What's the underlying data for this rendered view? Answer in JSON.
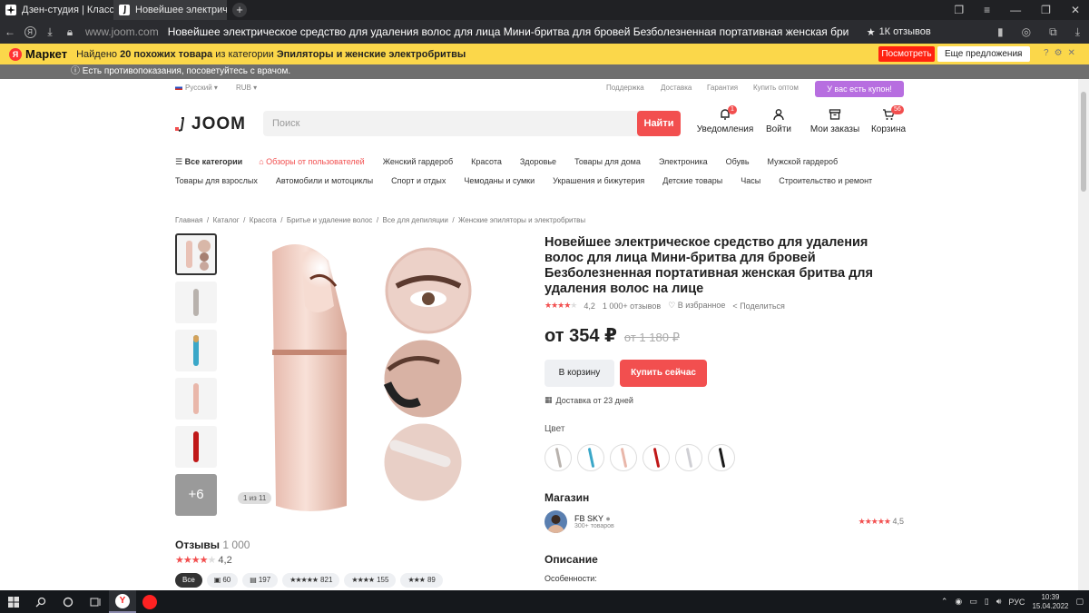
{
  "browser": {
    "tabs": [
      {
        "label": "Дзен-студия | Классный т"
      },
      {
        "label": "Новейшее электрическ"
      }
    ],
    "address_host": "www.joom.com",
    "page_title": "Новейшее электрическое средство для удаления волос для лица Мини-бритва для бровей Безболезненная портативная женская бритва для удаления волос не...",
    "reviews_pill": "1К отзывов"
  },
  "market_bar": {
    "brand": "Маркет",
    "text_pre": "Найдено ",
    "count": "20",
    "text_mid": " похожих товара",
    "text_post": " из категории ",
    "category": "Эпиляторы и женские электробритвы",
    "look_button": "Посмотреть",
    "more_offers": "Еще предложения"
  },
  "warning": "Есть противопоказания, посоветуйтесь с врачом.",
  "utility": {
    "language": "Русский",
    "currency": "RUB",
    "links": [
      "Поддержка",
      "Доставка",
      "Гарантия",
      "Купить оптом"
    ],
    "coupon": "У вас есть купон!"
  },
  "header": {
    "logo": "JOOM",
    "search_placeholder": "Поиск",
    "search_button": "Найти",
    "icons": [
      {
        "label": "Уведомления",
        "badge": "1"
      },
      {
        "label": "Войти",
        "badge": ""
      },
      {
        "label": "Мои заказы",
        "badge": ""
      },
      {
        "label": "Корзина",
        "badge": "56"
      }
    ]
  },
  "categories_row1": [
    "Все категории",
    "Обзоры от пользователей",
    "Женский гардероб",
    "Красота",
    "Здоровье",
    "Товары для дома",
    "Электроника",
    "Обувь",
    "Мужской гардероб"
  ],
  "categories_row2": [
    "Товары для взрослых",
    "Автомобили и мотоциклы",
    "Спорт и отдых",
    "Чемоданы и сумки",
    "Украшения и бижутерия",
    "Детские товары",
    "Часы",
    "Строительство и ремонт"
  ],
  "breadcrumbs": [
    "Главная",
    "Каталог",
    "Красота",
    "Бритье и удаление волос",
    "Все для депиляции",
    "Женские эпиляторы и электробритвы"
  ],
  "gallery": {
    "more": "+6",
    "counter": "1 из 11"
  },
  "product": {
    "title": "Новейшее электрическое средство для удаления волос для лица Мини-бритва для бровей Безболезненная портативная женская бритва для удаления волос на лице",
    "rating": "4,2",
    "reviews": "1 000+ отзывов",
    "favorite": "В избранное",
    "share": "Поделиться",
    "price": "от 354 ₽",
    "old_price": "от 1 180 ₽",
    "cart_button": "В корзину",
    "buy_button": "Купить сейчас",
    "delivery": "Доставка от 23 дней",
    "color_label": "Цвет",
    "colors": [
      "#b8b2ad",
      "#3aa7c8",
      "#e9b7aa",
      "#c01818",
      "#cfcfd4",
      "#1a1a1a"
    ]
  },
  "store": {
    "section": "Магазин",
    "name": "FB SKY",
    "products": "300+ товаров",
    "rating": "4,5"
  },
  "description": {
    "section": "Описание",
    "first_line": "Особенности:"
  },
  "reviews": {
    "title": "Отзывы",
    "count": "1 000",
    "rating": "4,2",
    "filters": [
      {
        "label": "Все",
        "stars": ""
      },
      {
        "label": "60",
        "stars": "▣"
      },
      {
        "label": "197",
        "stars": "▤"
      },
      {
        "label": "821",
        "stars": "★★★★★"
      },
      {
        "label": "155",
        "stars": "★★★★"
      },
      {
        "label": "89",
        "stars": "★★★"
      }
    ]
  },
  "taskbar": {
    "lang": "РУС",
    "time": "10:39",
    "date": "15.04.2022"
  }
}
